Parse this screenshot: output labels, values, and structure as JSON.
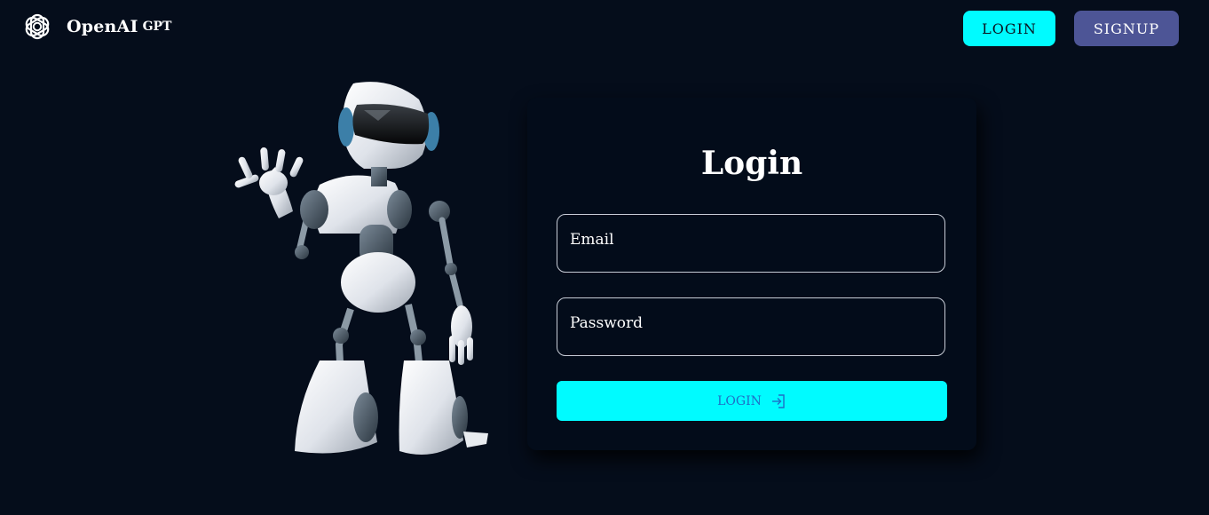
{
  "brand": {
    "name": "OpenAI",
    "suffix": "GPT",
    "logo_icon": "openai-logo-icon"
  },
  "nav": {
    "login_label": "LOGIN",
    "signup_label": "SIGNUP"
  },
  "illustration": {
    "icon": "waving-robot-illustration"
  },
  "form": {
    "title": "Login",
    "email_placeholder": "Email",
    "email_value": "",
    "password_placeholder": "Password",
    "password_value": "",
    "submit_label": "LOGIN",
    "submit_icon": "login-arrow-icon"
  },
  "colors": {
    "background": "#050d1b",
    "card": "#030c1a",
    "accent": "#00fbff",
    "signup": "#4d5596",
    "submit_text": "#1e6ec6"
  }
}
